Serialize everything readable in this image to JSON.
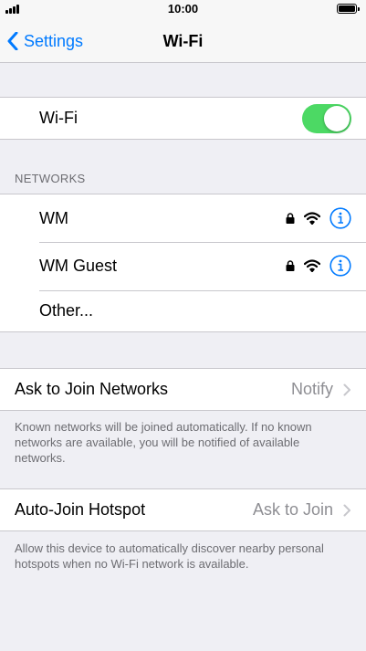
{
  "status_bar": {
    "time": "10:00"
  },
  "nav": {
    "back_label": "Settings",
    "title": "Wi-Fi"
  },
  "wifi_toggle": {
    "label": "Wi-Fi",
    "on": true,
    "color": "#4cd964"
  },
  "networks": {
    "header": "NETWORKS",
    "items": [
      {
        "name": "WM",
        "secured": true
      },
      {
        "name": "WM Guest",
        "secured": true
      },
      {
        "name": "Other..."
      }
    ]
  },
  "ask_to_join": {
    "label": "Ask to Join Networks",
    "value": "Notify",
    "footer": "Known networks will be joined automatically. If no known networks are available, you will be notified of available networks."
  },
  "auto_join_hotspot": {
    "label": "Auto-Join Hotspot",
    "value": "Ask to Join",
    "footer": "Allow this device to automatically discover nearby personal hotspots when no Wi-Fi network is available."
  },
  "colors": {
    "accent": "#007aff",
    "background": "#efeff4"
  }
}
